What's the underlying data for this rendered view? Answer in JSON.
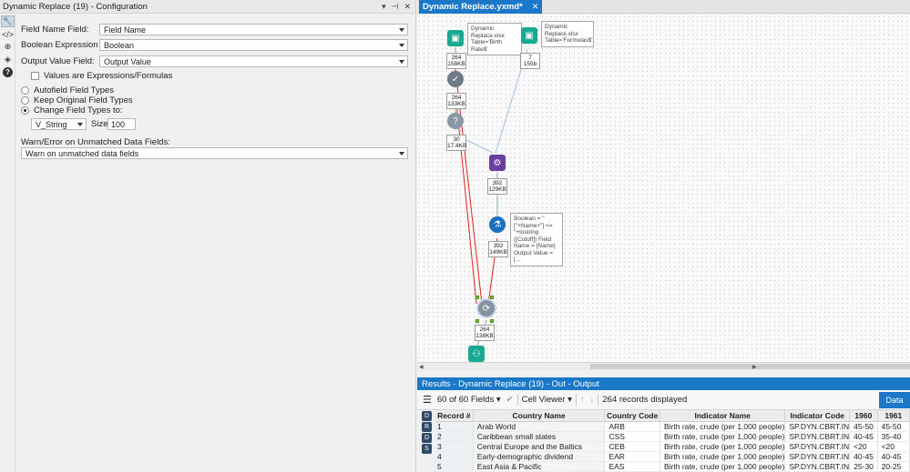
{
  "config": {
    "title": "Dynamic Replace (19) - Configuration",
    "header_controls": [
      "▾",
      "⊣",
      "✕"
    ],
    "field_name_label": "Field Name Field:",
    "field_name_value": "Field Name",
    "boolean_label": "Boolean Expression Field:",
    "boolean_value": "Boolean",
    "output_label": "Output Value Field:",
    "output_value": "Output Value",
    "values_expressions_label": "Values are Expressions/Formulas",
    "radio_autofield": "Autofield Field Types",
    "radio_keep": "Keep Original Field Types",
    "radio_change": "Change Field Types to:",
    "type_value": "V_String",
    "size_label": "Size:",
    "size_value": "100",
    "warn_label": "Warn/Error on Unmatched Data Fields:",
    "warn_value": "Warn on unmatched data fields"
  },
  "rail_icons": [
    "wrench-icon",
    "code-icon",
    "compass-icon",
    "tag-icon",
    "help-icon"
  ],
  "canvas": {
    "tab_label": "Dynamic Replace.yxmd*",
    "tab_close": "✕",
    "notes": {
      "input1": "Dynamic Replace.xlsx Table='Birth Rate$'",
      "input2": "Dynamic Replace.xlsx Table='Formulas$'",
      "formula": "Boolean = \"[\"+Name+\"] <= \"+tostring ([Cutoff]) Field Name = [Name] Output Value = [..."
    },
    "counts": {
      "input1": [
        "264",
        "158KB"
      ],
      "input2": [
        "7",
        "155b"
      ],
      "select": [
        "264",
        "133KB"
      ],
      "filter": [
        "30",
        "17.4KB"
      ],
      "append": [
        "392",
        "129KB"
      ],
      "formula": [
        "392",
        "149KB"
      ],
      "dynrep": [
        "264",
        "138KB"
      ]
    }
  },
  "results": {
    "title": "Results - Dynamic Replace (19) - Out - Output",
    "fields_label": "60 of 60 Fields",
    "viewer_label": "Cell Viewer",
    "records_label": "264 records displayed",
    "data_button": "Data",
    "columns": [
      "Record #",
      "Country Name",
      "Country Code",
      "Indicator Name",
      "Indicator Code",
      "1960",
      "1961"
    ],
    "rows": [
      [
        "1",
        "Arab World",
        "ARB",
        "Birth rate, crude (per 1,000 people)",
        "SP.DYN.CBRT.IN",
        "45-50",
        "45-50"
      ],
      [
        "2",
        "Caribbean small states",
        "CSS",
        "Birth rate, crude (per 1,000 people)",
        "SP.DYN.CBRT.IN",
        "40-45",
        "35-40"
      ],
      [
        "3",
        "Central Europe and the Baltics",
        "CEB",
        "Birth rate, crude (per 1,000 people)",
        "SP.DYN.CBRT.IN",
        "<20",
        "<20"
      ],
      [
        "4",
        "Early-demographic dividend",
        "EAR",
        "Birth rate, crude (per 1,000 people)",
        "SP.DYN.CBRT.IN",
        "40-45",
        "40-45"
      ],
      [
        "5",
        "East Asia & Pacific",
        "EAS",
        "Birth rate, crude (per 1,000 people)",
        "SP.DYN.CBRT.IN",
        "25-30",
        "20-25"
      ]
    ]
  }
}
